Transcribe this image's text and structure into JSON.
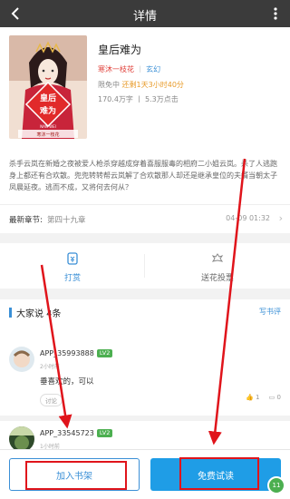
{
  "header": {
    "title": "详情",
    "back_icon": "back-arrow-icon",
    "more_icon": "more-vertical-icon"
  },
  "book": {
    "title": "皇后难为",
    "author": "寒沐一枝花",
    "genre": "玄幻",
    "free_label": "限免中",
    "free_countdown": "还剩1天3小时40分",
    "stats": "170.4万字 丨 5.3万点击",
    "cover": {
      "title_text": "皇后难为",
      "pinyin": "NAN WEI",
      "author_text": "寒沐一枝花",
      "colors": [
        "#c21f2b",
        "#f4d9c8",
        "#7a1b1b"
      ]
    },
    "description": "杀手云岚在新婚之夜被爱人枪杀穿越成穿着喜服服毒的相府二小姐云岚。杀了人逃跑身上都还有合欢散。兜兜转转帮云岚解了合欢散那人却还是继承皇位的夫婿当朝太子凤晨延夜。逃而不成，又将何去何从？"
  },
  "chapter": {
    "label": "最新章节:",
    "name": "第四十九章",
    "time": "04-09 01:32"
  },
  "actions": {
    "tip": "打赏",
    "flower": "送花投票"
  },
  "comments": {
    "header": "大家说 4条",
    "write": "写书评",
    "items": [
      {
        "user": "APP_35993888",
        "level": "LV2",
        "time": "2小时前",
        "text": "垂喜欢的，可以",
        "tag": "讨论",
        "likes": "1",
        "replies": "0"
      },
      {
        "user": "APP_33545723",
        "level": "LV2",
        "time": "1小时前"
      }
    ]
  },
  "bottom": {
    "add_shelf": "加入书架",
    "free_read": "免费试读",
    "badge": "11"
  },
  "accent": "#3a8fd6",
  "annotation_color": "#e0141b"
}
